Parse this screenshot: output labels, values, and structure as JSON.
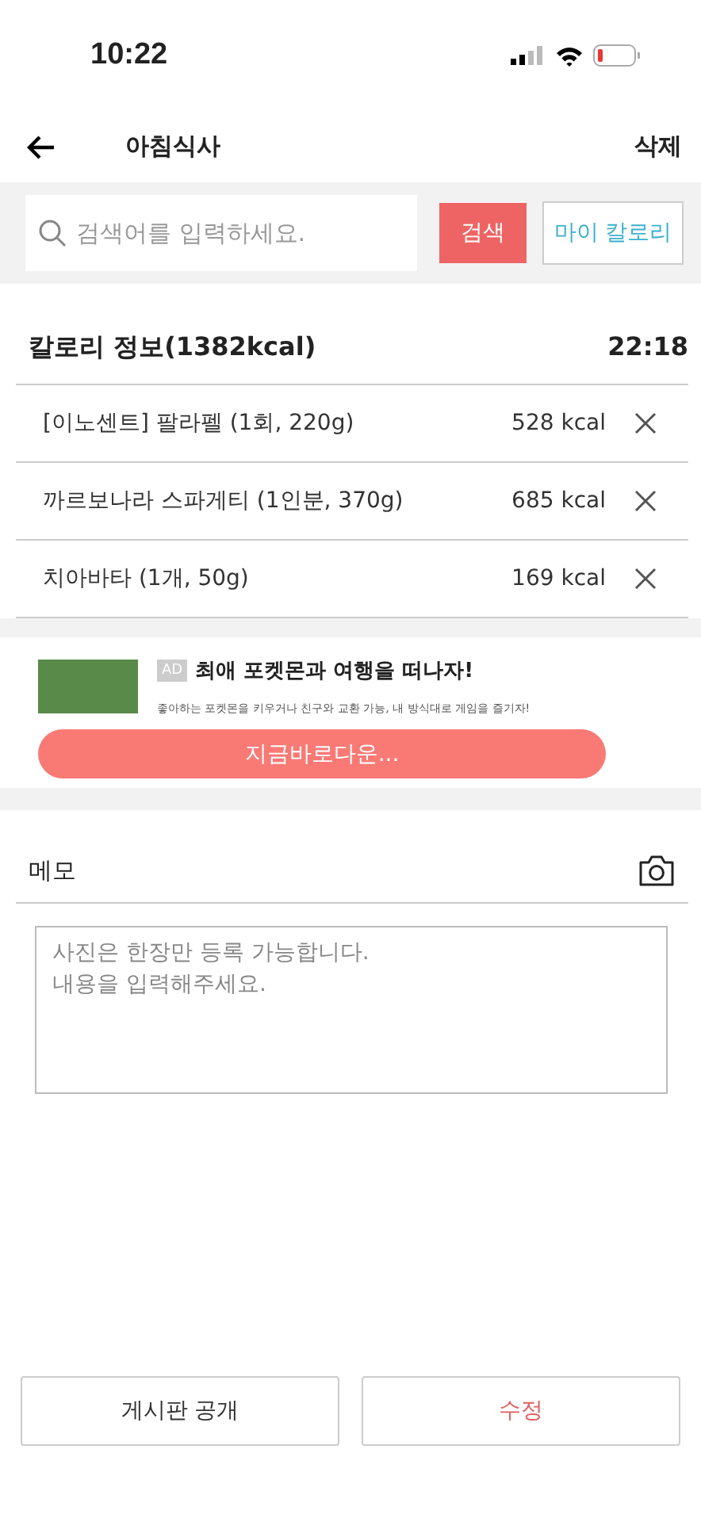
{
  "status_bar": {
    "time": "10:22"
  },
  "header": {
    "title": "아침식사",
    "action": "삭제"
  },
  "search": {
    "placeholder": "검색어를 입력하세요.",
    "search_button": "검색",
    "my_calorie_button": "마이 칼로리"
  },
  "calorie_info": {
    "title": "칼로리 정보(1382kcal)",
    "time": "22:18",
    "items": [
      {
        "name": "[이노센트] 팔라펠 (1회, 220g)",
        "kcal": "528 kcal"
      },
      {
        "name": "까르보나라 스파게티 (1인분, 370g)",
        "kcal": "685 kcal"
      },
      {
        "name": "치아바타 (1개, 50g)",
        "kcal": "169 kcal"
      }
    ]
  },
  "ad": {
    "badge": "AD",
    "title": "최애 포켓몬과 여행을 떠나자!",
    "description": "좋아하는 포켓몬을 키우거나 친구와 교환 가능, 내 방식대로 게임을 즐기자!",
    "button": "지금바로다운..."
  },
  "memo": {
    "title": "메모",
    "placeholder": "사진은 한장만 등록 가능합니다.\n내용을 입력해주세요."
  },
  "buttons": [
    {
      "label": "게시판 공개",
      "kind": "plain"
    },
    {
      "label": "수정",
      "kind": "accent"
    }
  ]
}
